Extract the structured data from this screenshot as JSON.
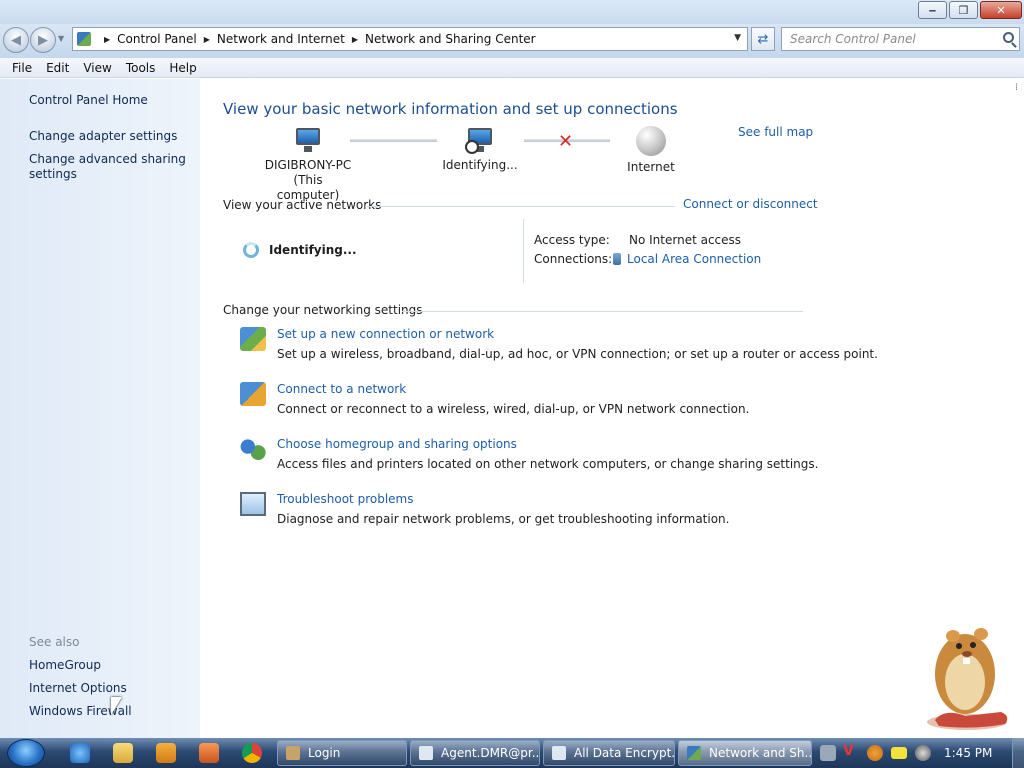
{
  "window": {
    "controls": [
      "minimize",
      "maximize",
      "close"
    ]
  },
  "address": {
    "crumbs": [
      "Control Panel",
      "Network and Internet",
      "Network and Sharing Center"
    ],
    "search_placeholder": "Search Control Panel"
  },
  "menu": [
    "File",
    "Edit",
    "View",
    "Tools",
    "Help"
  ],
  "sidebar": {
    "home": "Control Panel Home",
    "links": [
      "Change adapter settings",
      "Change advanced sharing settings"
    ],
    "see_also_label": "See also",
    "see_also": [
      "HomeGroup",
      "Internet Options",
      "Windows Firewall"
    ]
  },
  "main": {
    "title": "View your basic network information and set up connections",
    "see_full_map": "See full map",
    "map": {
      "computer_name": "DIGIBRONY-PC",
      "computer_sub": "(This computer)",
      "middle": "Identifying...",
      "internet": "Internet"
    },
    "active_networks": {
      "header": "View your active networks",
      "connect_link": "Connect or disconnect",
      "network_status": "Identifying...",
      "access_type_label": "Access type:",
      "access_type_value": "No Internet access",
      "connections_label": "Connections:",
      "connections_value": "Local Area Connection"
    },
    "settings_header": "Change your networking settings",
    "tasks": [
      {
        "title": "Set up a new connection or network",
        "desc": "Set up a wireless, broadband, dial-up, ad hoc, or VPN connection; or set up a router or access point.",
        "icon": "network-setup-icon"
      },
      {
        "title": "Connect to a network",
        "desc": "Connect or reconnect to a wireless, wired, dial-up, or VPN network connection.",
        "icon": "connect-network-icon"
      },
      {
        "title": "Choose homegroup and sharing options",
        "desc": "Access files and printers located on other network computers, or change sharing settings.",
        "icon": "homegroup-icon"
      },
      {
        "title": "Troubleshoot problems",
        "desc": "Diagnose and repair network problems, or get troubleshooting information.",
        "icon": "troubleshoot-icon"
      }
    ]
  },
  "taskbar": {
    "tasks": [
      "Login",
      "Agent.DMR@pr...",
      "All Data Encrypt...",
      "Network and Sh..."
    ],
    "clock": "1:45 PM"
  },
  "colors": {
    "link": "#1d5ea9",
    "title": "#1d4e8f",
    "sidebar_bg": "#dfeaf7",
    "taskbar": "#2c4a72"
  }
}
